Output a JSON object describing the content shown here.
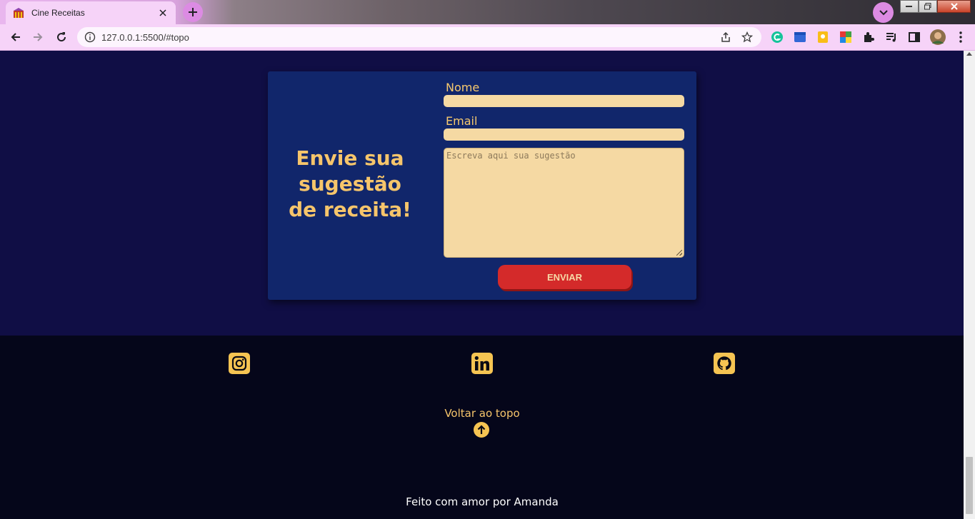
{
  "browser": {
    "tab_title": "Cine Receitas",
    "url": "127.0.0.1:5500/#topo",
    "icons": [
      "back-icon",
      "forward-icon",
      "reload-icon",
      "info-icon",
      "share-icon",
      "star-icon",
      "grammarly-icon",
      "calendar-extension-icon",
      "keep-icon",
      "color-extension-icon",
      "extensions-icon",
      "media-icon",
      "sidepanel-icon",
      "profile-avatar",
      "menu-icon"
    ]
  },
  "suggestion": {
    "heading": "Envie sua sugestão de receita!",
    "name_label": "Nome",
    "email_label": "Email",
    "message_placeholder": "Escreva aqui sua sugestão",
    "submit_label": "ENVIAR"
  },
  "footer": {
    "social": [
      "instagram-icon",
      "linkedin-icon",
      "github-icon"
    ],
    "back_to_top": "Voltar ao topo",
    "credit": "Feito com amor por Amanda"
  },
  "colors": {
    "section_bg": "#100e45",
    "card_bg": "#11266b",
    "accent": "#f6c56b",
    "input_bg": "#f5d9a3",
    "button": "#d42a2a",
    "footer_bg": "#05061a"
  }
}
